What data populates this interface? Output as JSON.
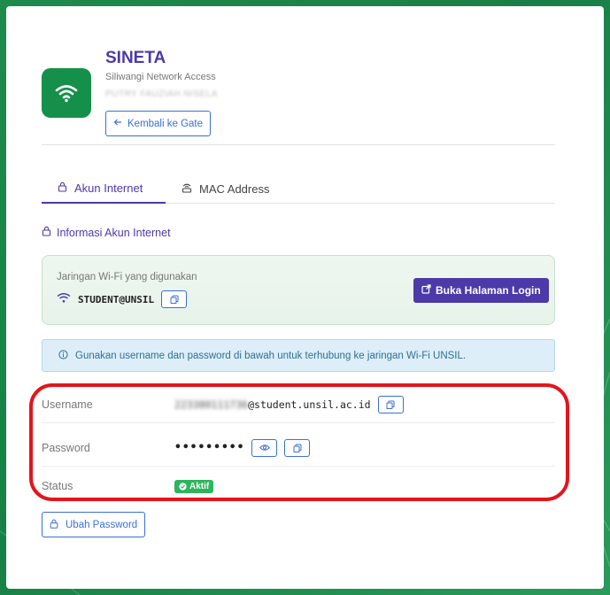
{
  "header": {
    "title": "SINETA",
    "subtitle": "Siliwangi Network Access",
    "user_name": "PUTRY FAUZIAH NISELA",
    "back_button": "Kembali ke Gate"
  },
  "tabs": [
    {
      "label": "Akun Internet",
      "active": true,
      "icon": "lock-icon"
    },
    {
      "label": "MAC Address",
      "active": false,
      "icon": "router-icon"
    }
  ],
  "section": {
    "title": "Informasi Akun Internet"
  },
  "wifi": {
    "label": "Jaringan Wi-Fi yang digunakan",
    "ssid": "STUDENT@UNSIL",
    "login_button": "Buka Halaman Login"
  },
  "info": {
    "text": "Gunakan username dan password di bawah untuk terhubung ke jaringan Wi-Fi UNSIL."
  },
  "credentials": {
    "username_label": "Username",
    "username_hidden": "223380111736",
    "username_domain": "@student.unsil.ac.id",
    "password_label": "Password",
    "password_masked": "•••••••••",
    "status_label": "Status",
    "status_value": "Aktif"
  },
  "change_password_button": "Ubah Password",
  "colors": {
    "primary": "#4b3aa8",
    "accent_blue": "#3a6fd8",
    "brand_green": "#15904a",
    "status_green": "#2db55d",
    "highlight_red": "#e4141c"
  }
}
